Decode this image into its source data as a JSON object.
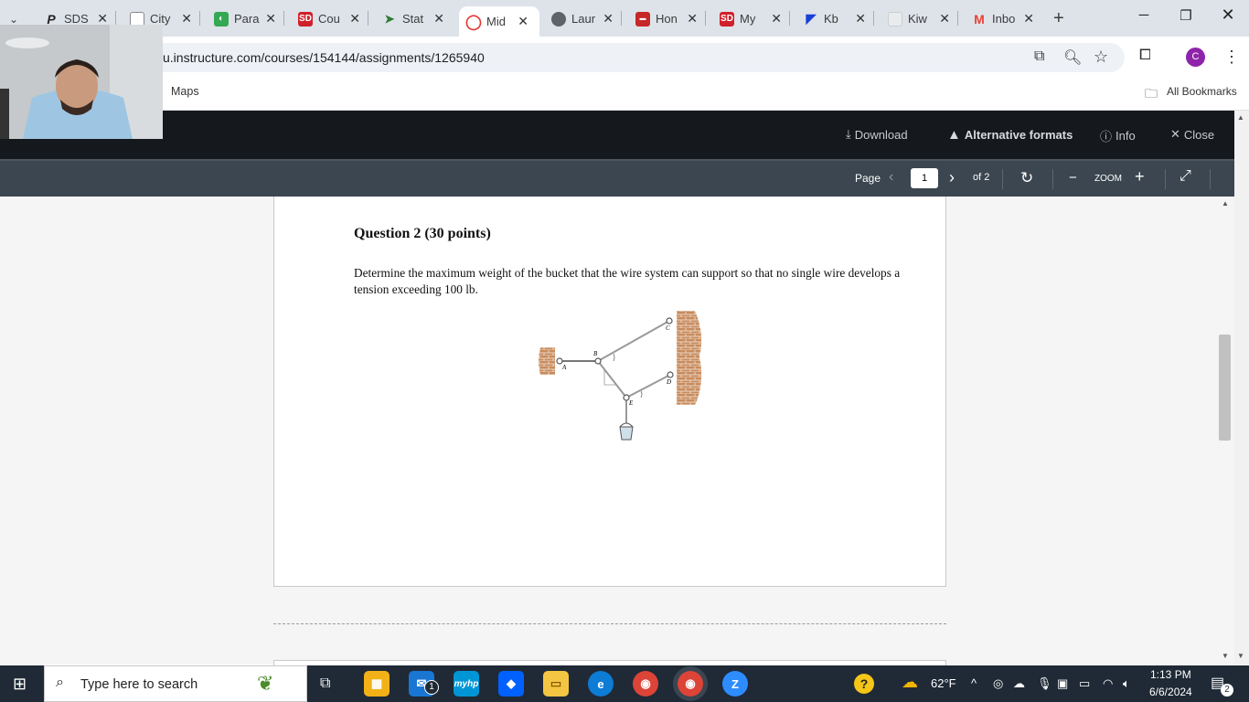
{
  "tabs": [
    {
      "title": "SDS",
      "fav": "P",
      "color": "#2d2d2d"
    },
    {
      "title": "City",
      "fav": "",
      "color": "#ffffff"
    },
    {
      "title": "Para",
      "fav": "◐",
      "color": "#34a853"
    },
    {
      "title": "Cou",
      "fav": "SD",
      "color": "#d0202a"
    },
    {
      "title": "Stat",
      "fav": "➤",
      "color": "#2e7d32"
    },
    {
      "title": "Mid",
      "fav": "◯",
      "color": "#e53935"
    },
    {
      "title": "Laur",
      "fav": "◍",
      "color": "#5f6368"
    },
    {
      "title": "Hon",
      "fav": "▬",
      "color": "#c62828"
    },
    {
      "title": "My",
      "fav": "SD",
      "color": "#d0202a"
    },
    {
      "title": "Kb",
      "fav": "◤",
      "color": "#1a3fd6"
    },
    {
      "title": "Kiw",
      "fav": "·",
      "color": "#cfd4d9"
    },
    {
      "title": "Inbo",
      "fav": "M",
      "color": "#ea4335"
    }
  ],
  "address": {
    "url": "u.instructure.com/courses/154144/assignments/1265940"
  },
  "bookmarks": {
    "maps": "Maps",
    "all": "All Bookmarks"
  },
  "profile_initial": "C",
  "viewer": {
    "download": "Download",
    "alternative": "Alternative formats",
    "info": "Info",
    "close": "Close",
    "page_label": "Page",
    "page_value": "1",
    "of_total": "of 2",
    "zoom": "ZOOM"
  },
  "document": {
    "title": "Question 2 (30 points)",
    "body": "Determine the maximum weight of the bucket that the wire system can support so that no single wire develops a tension exceeding 100 lb.",
    "figure_labels": {
      "a": "A",
      "b": "B",
      "c": "C",
      "d": "D",
      "e": "E"
    }
  },
  "taskbar": {
    "search_placeholder": "Type here to search",
    "weather": "62°F",
    "time": "1:13 PM",
    "date": "6/6/2024",
    "notifications": "2",
    "mail_badge": "1"
  },
  "colors": {
    "viewer_dark": "#15181c",
    "viewer_bar": "#3b4650",
    "taskbar": "#1f2a36",
    "tabstrip": "#dee3ea"
  }
}
